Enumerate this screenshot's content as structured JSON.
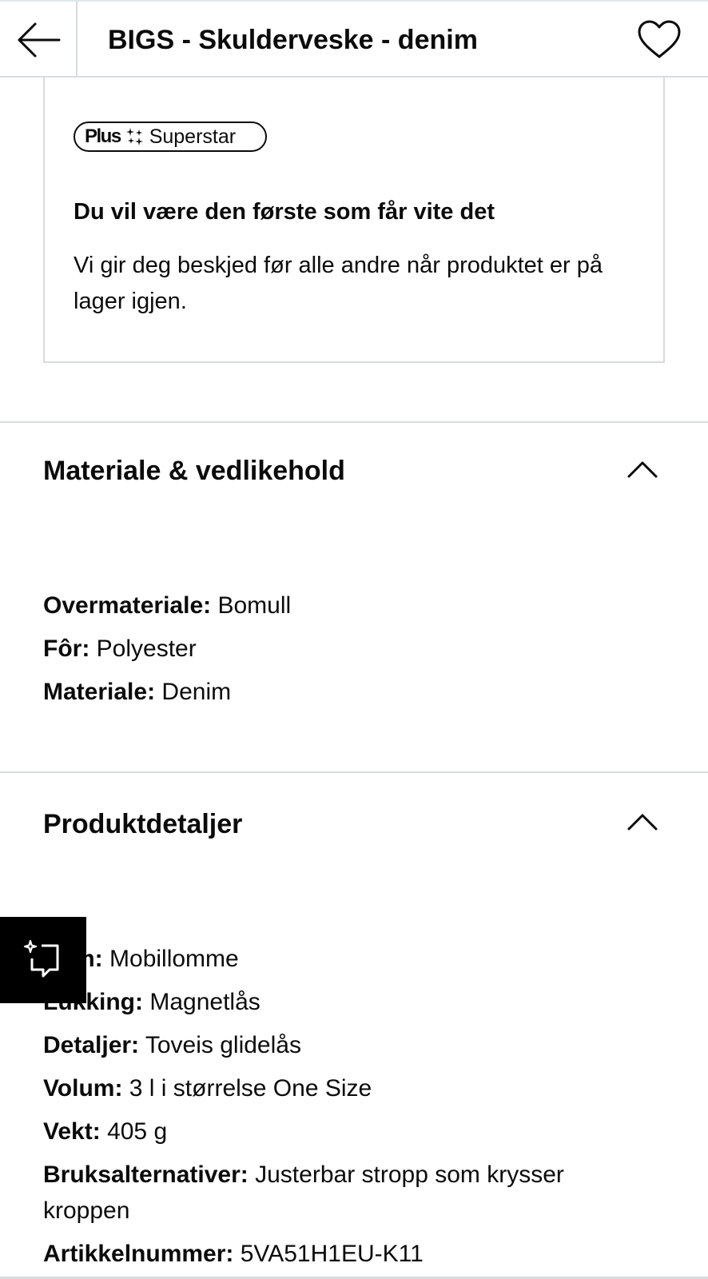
{
  "header": {
    "title": "BIGS - Skulderveske - denim",
    "back_icon": "arrow-left-icon",
    "favorite_icon": "heart-icon"
  },
  "plus_box": {
    "badge_plus": "Plus",
    "badge_icon": "sparkle-icon",
    "badge_label": "Superstar",
    "heading": "Du vil være den første som får vite det",
    "text": "Vi gir deg beskjed før alle andre når produktet er på lager igjen."
  },
  "material_section": {
    "title": "Materiale & vedlikehold",
    "chevron_icon": "chevron-up-icon",
    "items": [
      {
        "label": "Overmateriale:",
        "value": "Bomull"
      },
      {
        "label": "Fôr:",
        "value": "Polyester"
      },
      {
        "label": "Materiale:",
        "value": "Denim"
      }
    ]
  },
  "details_section": {
    "title": "Produktdetaljer",
    "chevron_icon": "chevron-up-icon",
    "items": [
      {
        "label": "m:",
        "value": "Mobillomme"
      },
      {
        "label": "Lukking:",
        "value": "Magnetlås"
      },
      {
        "label": "Detaljer:",
        "value": "Toveis glidelås"
      },
      {
        "label": "Volum:",
        "value": "3 l i størrelse One Size"
      },
      {
        "label": "Vekt:",
        "value": "405 g"
      },
      {
        "label": "Bruksalternativer:",
        "value": "Justerbar stropp som krysser",
        "value_cont": "kroppen"
      },
      {
        "label": "Artikkelnummer:",
        "value": "5VA51H1EU-K11"
      }
    ]
  },
  "fab": {
    "icon": "ai-assistant-icon"
  }
}
